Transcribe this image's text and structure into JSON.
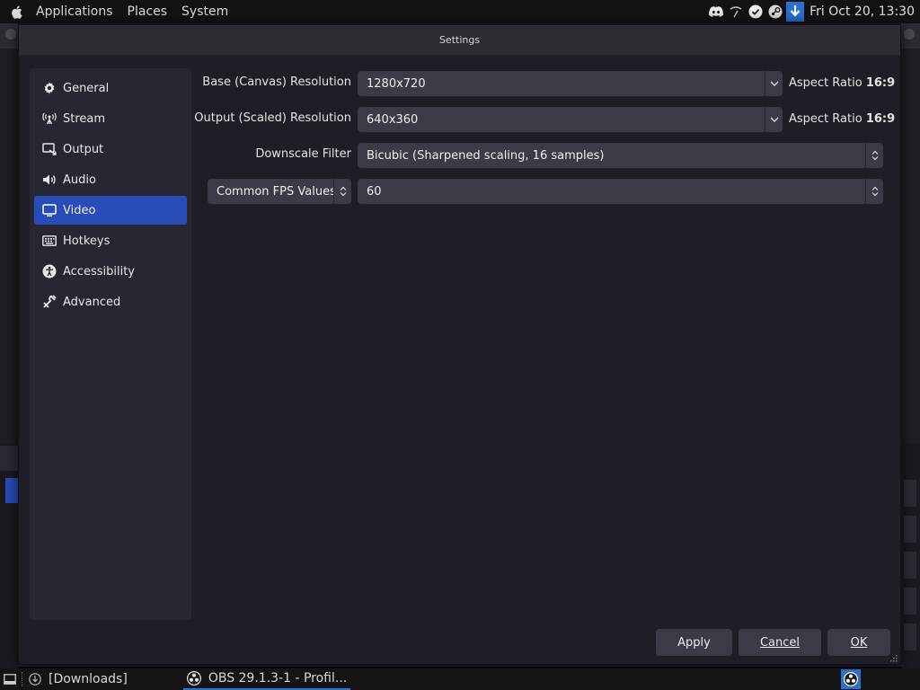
{
  "top_panel": {
    "menus": [
      "Applications",
      "Places",
      "System"
    ],
    "clock": "Fri Oct 20, 13:30",
    "tray_icons": [
      "discord-icon",
      "network-icon",
      "check-icon",
      "steam-icon",
      "download-icon"
    ]
  },
  "dialog": {
    "title": "Settings",
    "sidebar": [
      {
        "label": "General",
        "icon": "gear-icon"
      },
      {
        "label": "Stream",
        "icon": "antenna-icon"
      },
      {
        "label": "Output",
        "icon": "output-icon"
      },
      {
        "label": "Audio",
        "icon": "speaker-icon"
      },
      {
        "label": "Video",
        "icon": "monitor-icon",
        "active": true
      },
      {
        "label": "Hotkeys",
        "icon": "keyboard-icon"
      },
      {
        "label": "Accessibility",
        "icon": "accessibility-icon"
      },
      {
        "label": "Advanced",
        "icon": "tools-icon"
      }
    ],
    "video": {
      "base_label": "Base (Canvas) Resolution",
      "base_value": "1280x720",
      "base_aspect_prefix": "Aspect Ratio",
      "base_aspect_value": "16:9",
      "output_label": "Output (Scaled) Resolution",
      "output_value": "640x360",
      "output_aspect_prefix": "Aspect Ratio",
      "output_aspect_value": "16:9",
      "filter_label": "Downscale Filter",
      "filter_value": "Bicubic (Sharpened scaling, 16 samples)",
      "fps_type": "Common FPS Values",
      "fps_value": "60"
    },
    "buttons": {
      "apply": "Apply",
      "cancel": "Cancel",
      "ok": "OK"
    }
  },
  "taskbar": {
    "downloads": "[Downloads]",
    "obs_task": "OBS 29.1.3-1 - Profil..."
  },
  "colors": {
    "accent": "#284cb8",
    "panel": "#131313",
    "dialog_bg": "#1f1e26"
  }
}
